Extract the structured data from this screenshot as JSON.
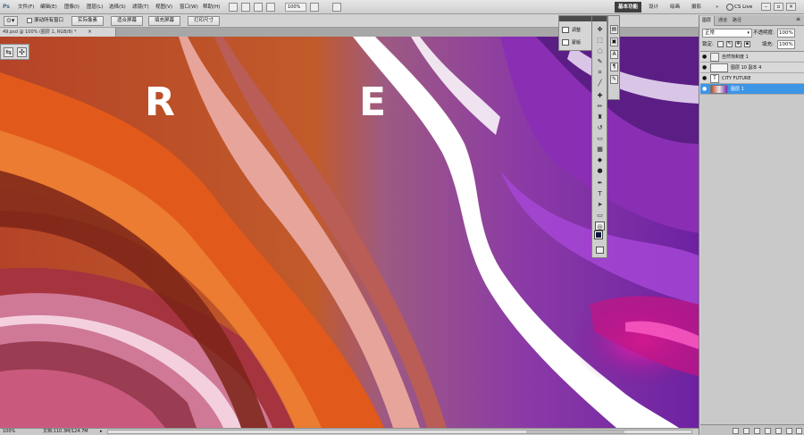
{
  "app": {
    "logo": "Ps",
    "menus": [
      "文件(F)",
      "编辑(E)",
      "图像(I)",
      "图层(L)",
      "选择(S)",
      "滤镜(T)",
      "视图(V)",
      "窗口(W)",
      "帮助(H)"
    ],
    "zoom_level": "100%",
    "workspaces": {
      "basic": "基本功能",
      "design": "设计",
      "paint": "绘画",
      "photo": "摄影",
      "more": "»"
    },
    "cs_live": "CS Live"
  },
  "options": {
    "scroll_all_windows": "滚动所有窗口",
    "buttons": [
      "实际像素",
      "适合屏幕",
      "填充屏幕",
      "打印尺寸"
    ]
  },
  "document": {
    "tab_title": "49.psd @ 100% (图层 1, RGB/8) *",
    "close": "×",
    "letters": [
      "R",
      "E"
    ],
    "colors": {
      "orange": "#e0541a",
      "red": "#9a2a1c",
      "pink": "#d48aa8",
      "magenta": "#d11a8f",
      "purple": "#7a2aa5",
      "violet": "#9c3bd0",
      "white": "#ffffff"
    }
  },
  "adjust_panel": {
    "adjust": "调整",
    "mask": "蒙版"
  },
  "toolbox": {
    "tools": [
      "move-tool",
      "marquee-tool",
      "lasso-tool",
      "quick-select-tool",
      "crop-tool",
      "eyedropper-tool",
      "healing-brush-tool",
      "brush-tool",
      "clone-stamp-tool",
      "history-brush-tool",
      "eraser-tool",
      "gradient-tool",
      "blur-tool",
      "dodge-tool",
      "pen-tool",
      "type-tool",
      "path-select-tool",
      "shape-tool",
      "3d-rotate-tool",
      "hand-tool",
      "zoom-tool"
    ],
    "foreground_color": "#0d1540",
    "background_color": "#ffffff"
  },
  "layers_panel": {
    "tabs": {
      "layers": "图层",
      "channels": "通道",
      "paths": "路径"
    },
    "blend_mode": "正常",
    "opacity_label": "不透明度:",
    "opacity_value": "100%",
    "lock_label": "锁定:",
    "fill_label": "填充:",
    "fill_value": "100%",
    "layers": [
      {
        "name": "自然饱和度 1",
        "selected": false
      },
      {
        "name": "图层 10 副本 4",
        "selected": false
      },
      {
        "name": "CITY FUTURE",
        "selected": false
      },
      {
        "name": "图层 1",
        "selected": true
      }
    ]
  },
  "status": {
    "zoom": "100%",
    "doc_size": "文档:110.3M/124.7M",
    "arrow": "▸"
  }
}
